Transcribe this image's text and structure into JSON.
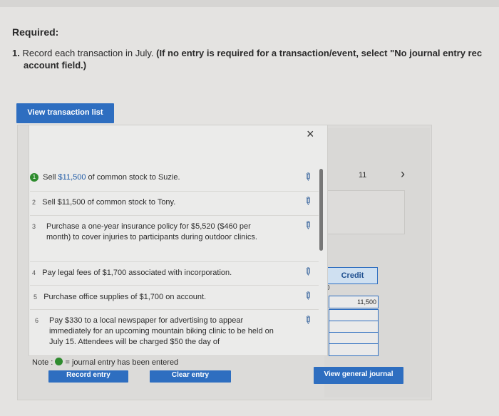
{
  "header": {
    "required_label": "Required:",
    "instruction_num": "1.",
    "instruction_text": "Record each transaction in July.",
    "instruction_bold": "(If no entry is required for a transaction/event, select \"No journal entry rec",
    "instruction_line2": "account field.)"
  },
  "buttons": {
    "view_transaction_list": "View transaction list",
    "record_entry": "Record entry",
    "clear_entry": "Clear entry",
    "view_general_journal": "View general journal"
  },
  "popup": {
    "close_icon": "×",
    "transactions": [
      {
        "num": "1",
        "text_pre": "Sell ",
        "text_highlight": "$11,500",
        "text_post": " of common stock to Suzie."
      },
      {
        "num": "2",
        "text": "Sell $11,500 of common stock to Tony."
      },
      {
        "num": "3",
        "text": "Purchase a one-year insurance policy for $5,520 ($460 per month) to cover injuries to participants during outdoor clinics."
      },
      {
        "num": "4",
        "text": "Pay legal fees of $1,700 associated with incorporation."
      },
      {
        "num": "5",
        "text": "Purchase office supplies of $1,700 on account."
      },
      {
        "num": "6",
        "text": "Pay $330 to a local newspaper for advertising to appear immediately for an upcoming mountain biking clinic to be held on July 15. Attendees will be charged $50 the day of"
      }
    ],
    "note_label": "Note :",
    "note_text": "= journal entry has been entered"
  },
  "journal": {
    "entry_number": "11",
    "chevron": "›",
    "credit_header": "Credit",
    "zero_marker": "0",
    "credit_value": "11,500"
  },
  "colors": {
    "accent": "#2e6ec0",
    "entered_dot": "#2e8b2e"
  }
}
